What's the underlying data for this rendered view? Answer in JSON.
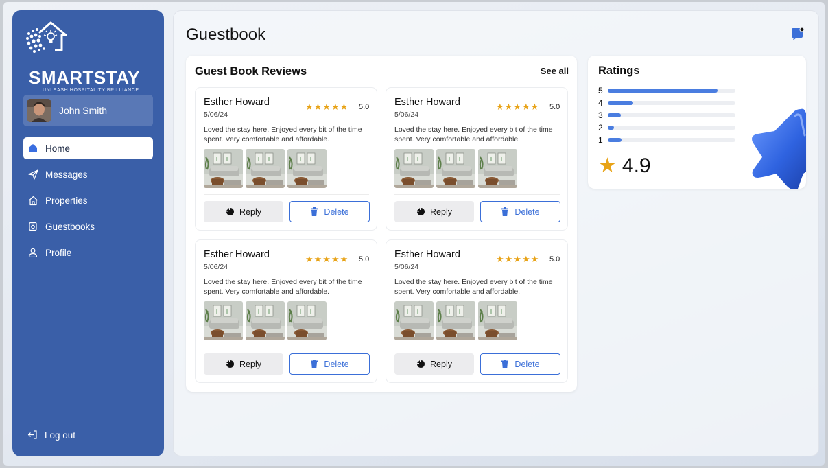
{
  "brand": {
    "name": "SMARTSTAY",
    "tagline": "UNLEASH HOSPITALITY BRILLIANCE"
  },
  "user": {
    "name": "John Smith"
  },
  "nav": {
    "items": [
      {
        "label": "Home",
        "icon": "home-icon",
        "active": true
      },
      {
        "label": "Messages",
        "icon": "send-icon",
        "active": false
      },
      {
        "label": "Properties",
        "icon": "house-outline-icon",
        "active": false
      },
      {
        "label": "Guestbooks",
        "icon": "book-icon",
        "active": false
      },
      {
        "label": "Profile",
        "icon": "person-icon",
        "active": false
      }
    ],
    "logout": "Log out"
  },
  "page": {
    "title": "Guestbook",
    "chat_icon": "chat-bubble-icon"
  },
  "reviews": {
    "title": "Guest Book Reviews",
    "see_all": "See all",
    "cards": [
      {
        "name": "Esther Howard",
        "date": "5/06/24",
        "stars": "★★★★★",
        "score": "5.0",
        "text": "Loved the stay here. Enjoyed every bit of the time spent. Very comfortable and affordable.",
        "reply": "Reply",
        "delete": "Delete"
      },
      {
        "name": "Esther Howard",
        "date": "5/06/24",
        "stars": "★★★★★",
        "score": "5.0",
        "text": "Loved the stay here. Enjoyed every bit of the time spent. Very comfortable and affordable.",
        "reply": "Reply",
        "delete": "Delete"
      },
      {
        "name": "Esther Howard",
        "date": "5/06/24",
        "stars": "★★★★★",
        "score": "5.0",
        "text": "Loved the stay here. Enjoyed every bit of the time spent. Very comfortable and affordable.",
        "reply": "Reply",
        "delete": "Delete"
      },
      {
        "name": "Esther Howard",
        "date": "5/06/24",
        "stars": "★★★★★",
        "score": "5.0",
        "text": "Loved the stay here. Enjoyed every bit of the time spent. Very comfortable and affordable.",
        "reply": "Reply",
        "delete": "Delete"
      }
    ]
  },
  "ratings": {
    "title": "Ratings",
    "rows": [
      {
        "label": "5",
        "fraction": 0.86
      },
      {
        "label": "4",
        "fraction": 0.2
      },
      {
        "label": "3",
        "fraction": 0.1
      },
      {
        "label": "2",
        "fraction": 0.05
      },
      {
        "label": "1",
        "fraction": 0.11
      }
    ],
    "average": "4.9",
    "star": "★"
  },
  "colors": {
    "sidebar": "#3a5fa8",
    "accent": "#3b6fd8",
    "star": "#e8a317",
    "bar": "#4a7de0"
  }
}
